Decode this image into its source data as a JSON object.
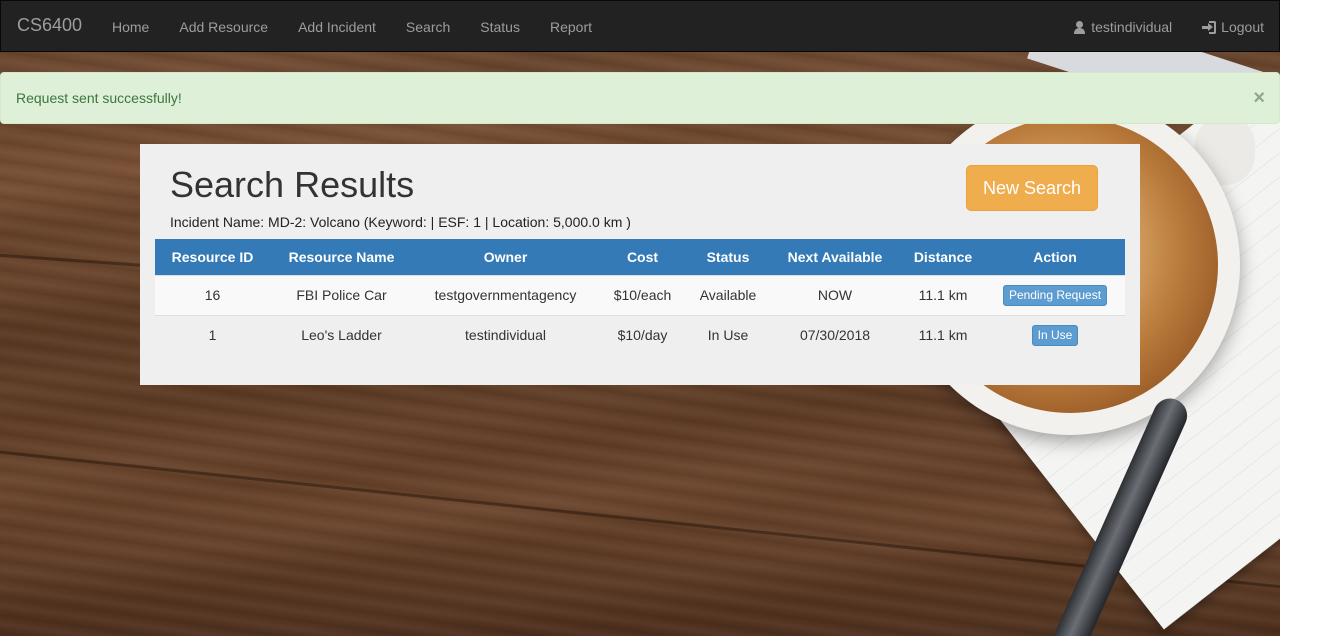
{
  "navbar": {
    "brand": "CS6400",
    "links": [
      "Home",
      "Add Resource",
      "Add Incident",
      "Search",
      "Status",
      "Report"
    ],
    "user": "testindividual",
    "logout": "Logout"
  },
  "alert": {
    "message": "Request sent successfully!",
    "close": "×"
  },
  "panel": {
    "title": "Search Results",
    "subtitle": "Incident Name: MD-2: Volcano (Keyword: | ESF: 1 | Location: 5,000.0 km )",
    "new_search": "New Search"
  },
  "table": {
    "headers": [
      "Resource ID",
      "Resource Name",
      "Owner",
      "Cost",
      "Status",
      "Next Available",
      "Distance",
      "Action"
    ],
    "rows": [
      [
        "16",
        "FBI Police Car",
        "testgovernmentagency",
        "$10/each",
        "Available",
        "NOW",
        "11.1 km",
        "Pending Request"
      ],
      [
        "1",
        "Leo's Ladder",
        "testindividual",
        "$10/day",
        "In Use",
        "07/30/2018",
        "11.1 km",
        "In Use"
      ]
    ]
  },
  "colors": {
    "navbar_bg": "#222222",
    "alert_bg": "#dff0d8",
    "table_header": "#337ab7",
    "new_search_button": "#f0ad4e",
    "action_button": "#5d9cd0"
  },
  "icons": {
    "user": "user-icon",
    "logout": "logout-icon"
  }
}
